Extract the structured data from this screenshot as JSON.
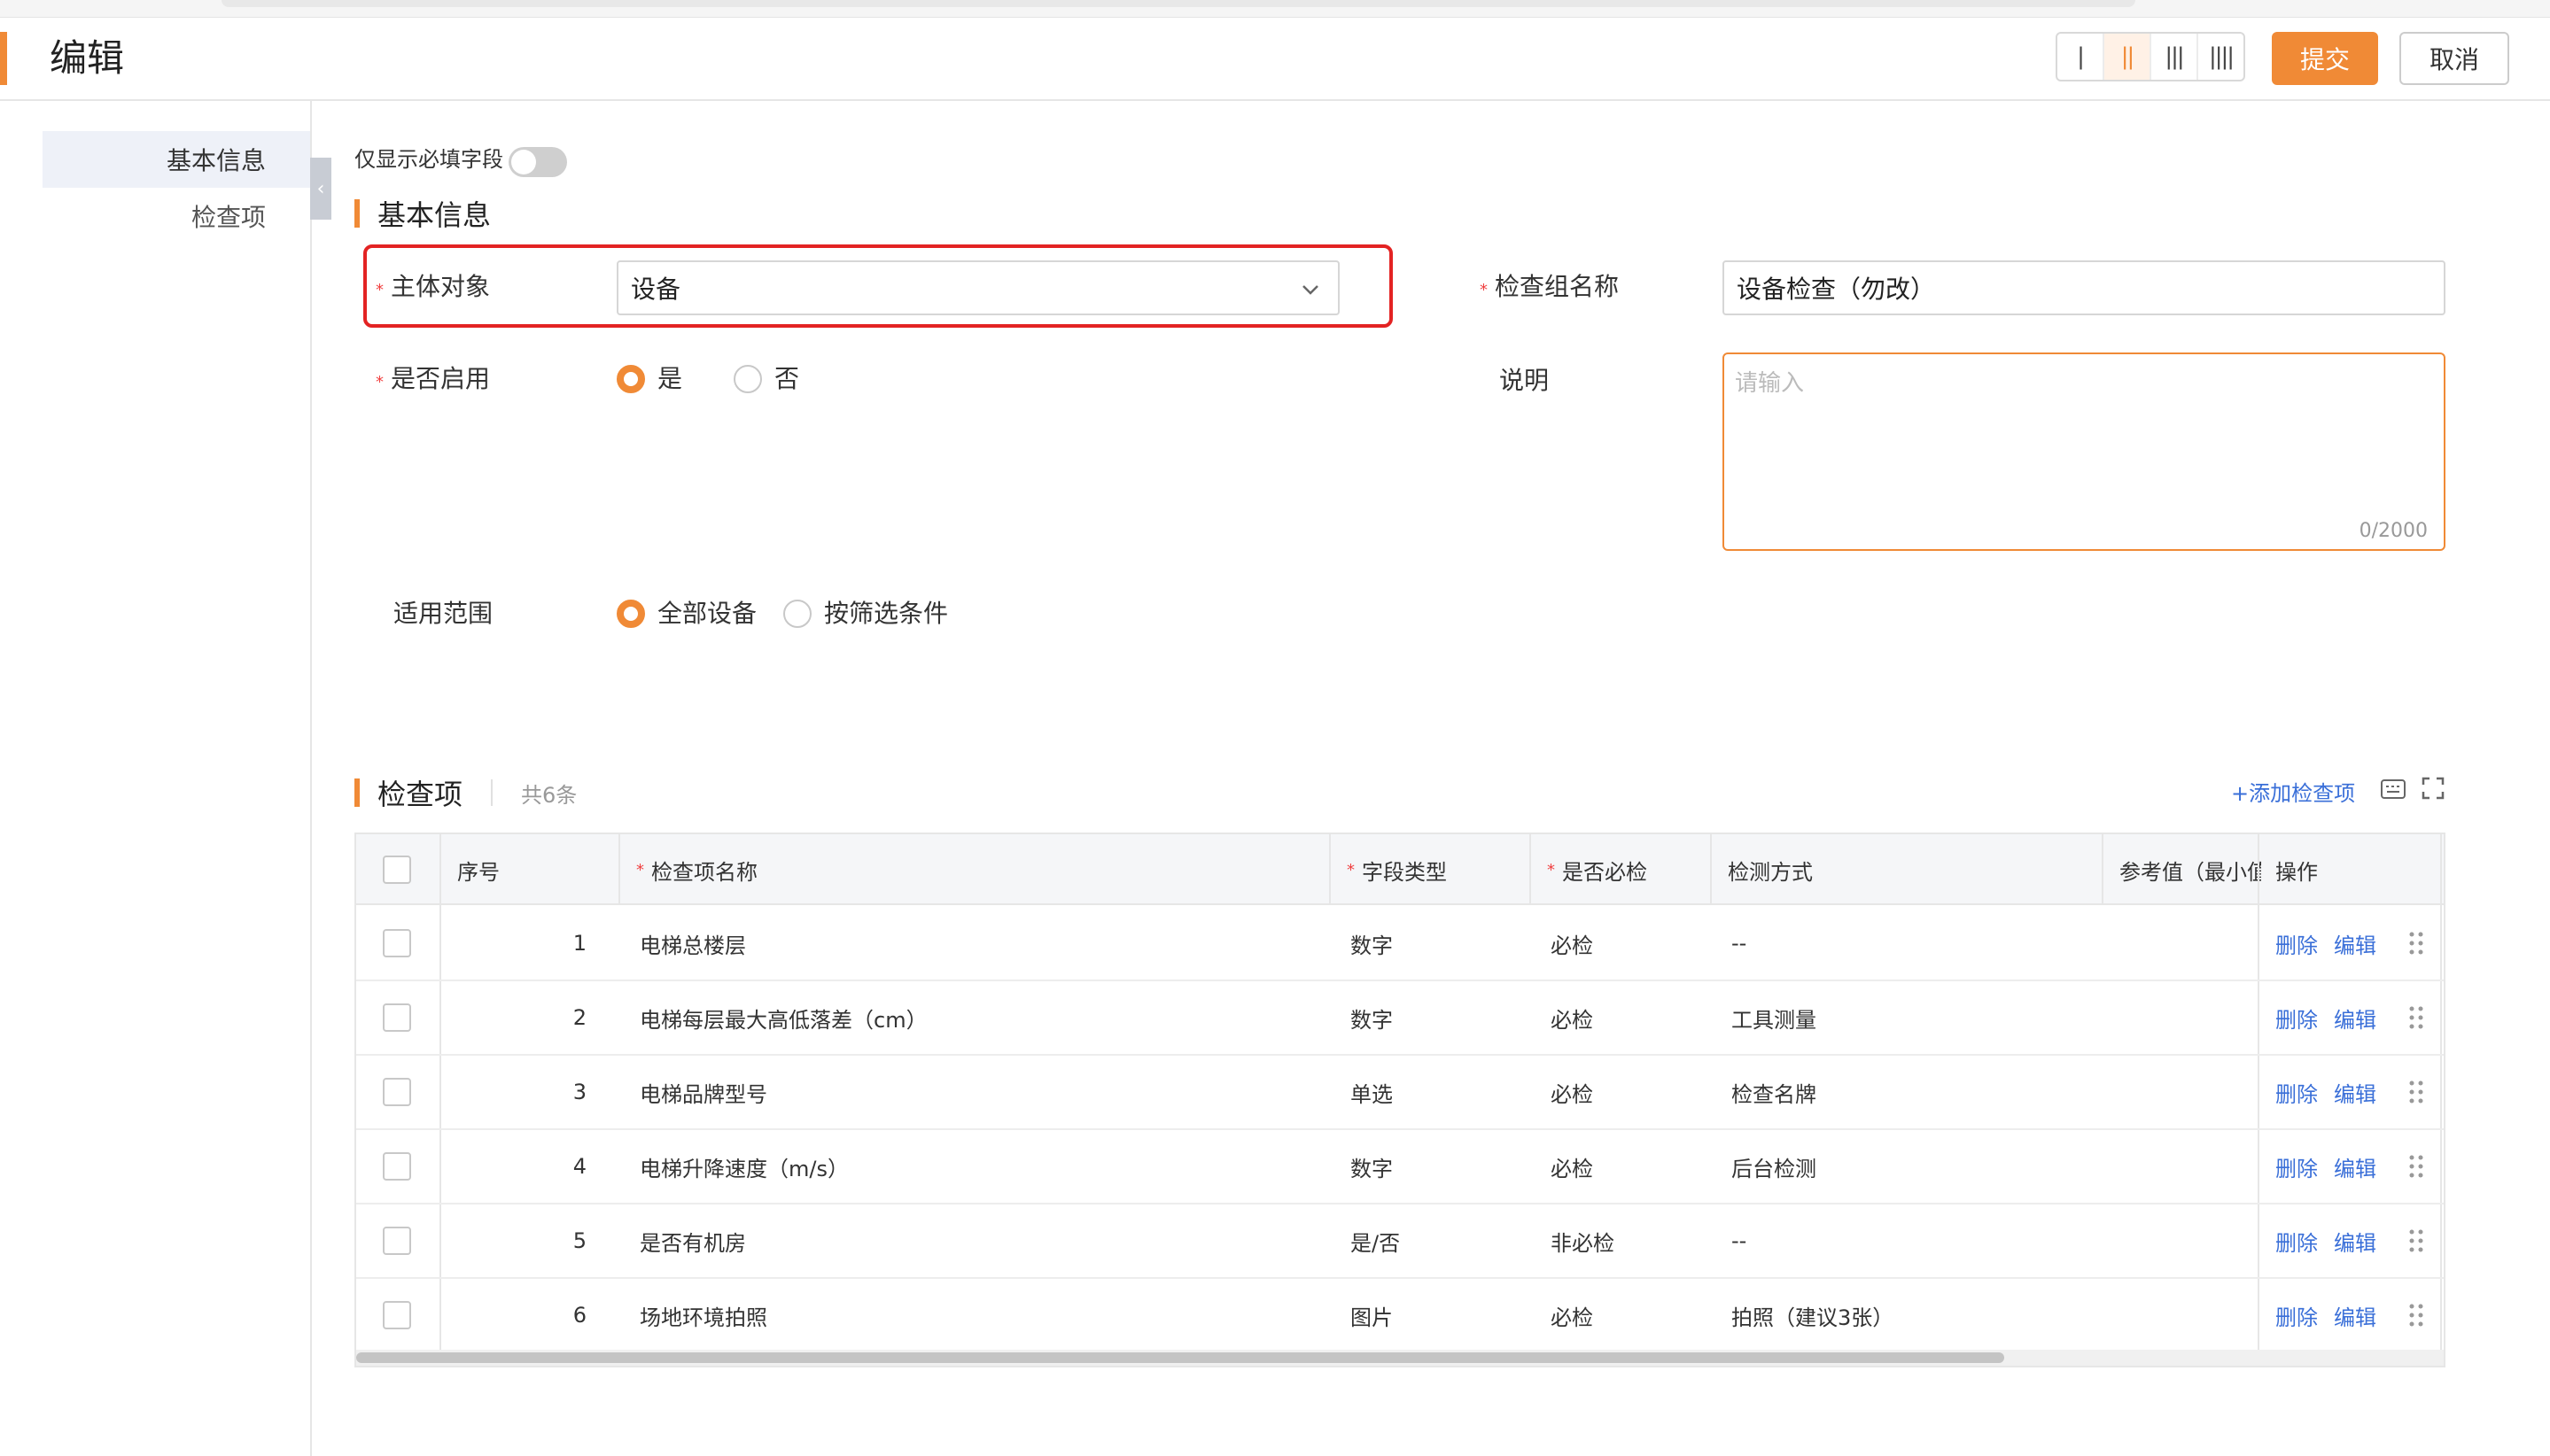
{
  "header": {
    "title": "编辑",
    "submit_label": "提交",
    "cancel_label": "取消",
    "col_options": [
      "|",
      "||",
      "|||",
      "||||"
    ]
  },
  "sidebar": {
    "items": [
      {
        "label": "基本信息"
      },
      {
        "label": "检查项"
      }
    ]
  },
  "collapse_glyph": "‹",
  "toggle_label": "仅显示必填字段",
  "basic": {
    "section_title": "基本信息",
    "subject_label": "主体对象",
    "subject_value": "设备",
    "group_label": "检查组名称",
    "group_value": "设备检查（勿改）",
    "enabled_label": "是否启用",
    "enabled_yes": "是",
    "enabled_no": "否",
    "desc_label": "说明",
    "desc_placeholder": "请输入",
    "desc_counter": "0/2000",
    "scope_label": "适用范围",
    "scope_all": "全部设备",
    "scope_filter": "按筛选条件"
  },
  "items": {
    "section_title": "检查项",
    "count": "共6条",
    "add_label": "+添加检查项",
    "columns": {
      "seq": "序号",
      "name": "检查项名称",
      "type": "字段类型",
      "required": "是否必检",
      "method": "检测方式",
      "ref": "参考值（最小值",
      "ops": "操作"
    },
    "delete_label": "删除",
    "edit_label": "编辑",
    "rows": [
      {
        "seq": "1",
        "name": "电梯总楼层",
        "type": "数字",
        "required": "必检",
        "method": "--"
      },
      {
        "seq": "2",
        "name": "电梯每层最大高低落差（cm）",
        "type": "数字",
        "required": "必检",
        "method": "工具测量"
      },
      {
        "seq": "3",
        "name": "电梯品牌型号",
        "type": "单选",
        "required": "必检",
        "method": "检查名牌"
      },
      {
        "seq": "4",
        "name": "电梯升降速度（m/s）",
        "type": "数字",
        "required": "必检",
        "method": "后台检测"
      },
      {
        "seq": "5",
        "name": "是否有机房",
        "type": "是/否",
        "required": "非必检",
        "method": "--"
      },
      {
        "seq": "6",
        "name": "场地环境拍照",
        "type": "图片",
        "required": "必检",
        "method": "拍照（建议3张）"
      }
    ]
  },
  "colors": {
    "accent": "#f08a36",
    "link": "#3a6fd8",
    "highlight": "#e32323"
  }
}
